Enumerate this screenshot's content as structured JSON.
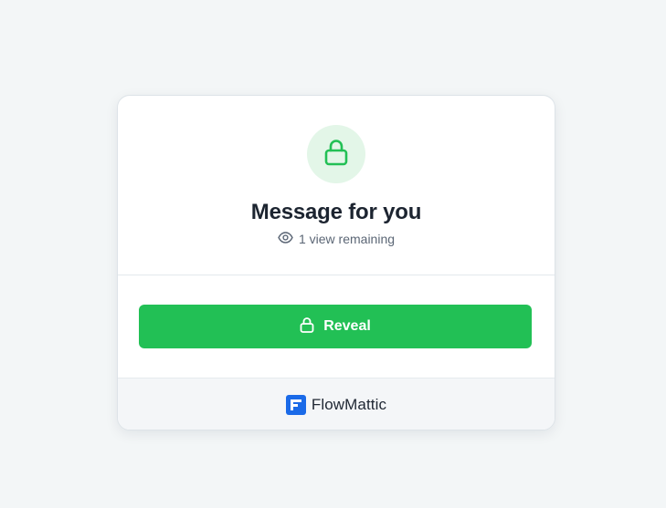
{
  "card": {
    "title": "Message for you",
    "views_remaining": "1 view remaining",
    "reveal_label": "Reveal"
  },
  "footer": {
    "brand_name": "FlowMattic"
  },
  "colors": {
    "accent_green": "#22c055",
    "badge_bg": "#e3f6e8",
    "brand_blue": "#1a6ae8"
  },
  "icons": {
    "badge": "lock-icon",
    "views": "eye-icon",
    "button": "lock-icon",
    "brand": "flowmattic-logo-icon"
  }
}
